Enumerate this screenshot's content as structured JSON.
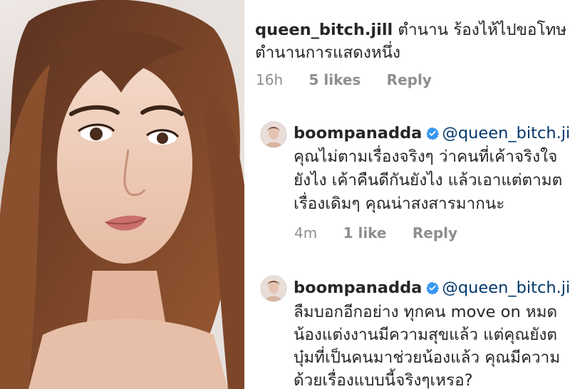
{
  "comments": [
    {
      "username": "queen_bitch.jill",
      "mention": "",
      "text_lines": [
        "ตำนาน ร้องไห้ไปขอโทษ",
        "ตำนานการแสดงหนึ่ง"
      ],
      "time": "16h",
      "likes": "5 likes",
      "reply": "Reply"
    },
    {
      "username": "boompanadda",
      "mention": "@queen_bitch.ji",
      "text_lines": [
        "คุณไม่ตามเรื่องจริงๆ ว่าคนที่เค้าจริงใจ",
        "ยังไง เค้าคืนดีกันยังไง แล้วเอาแต่ตามต",
        "เรื่องเดิมๆ คุณน่าสงสารมากนะ"
      ],
      "time": "4m",
      "likes": "1 like",
      "reply": "Reply"
    },
    {
      "username": "boompanadda",
      "mention": "@queen_bitch.ji",
      "text_lines": [
        "ลืมบอกอีกอย่าง ทุกคน move on หมด",
        "น้องแต่งงานมีความสุขแล้ว แต่คุณยังต",
        "บุ๋มที่เป็นคนมาช่วยน้องแล้ว คุณมีความ",
        "ด้วยเรื่องแบบนี้จริงๆเหรอ?"
      ]
    }
  ],
  "colors": {
    "mention": "#00376b",
    "verified": "#3897f0",
    "meta": "#8e8e8e",
    "text": "#262626"
  }
}
